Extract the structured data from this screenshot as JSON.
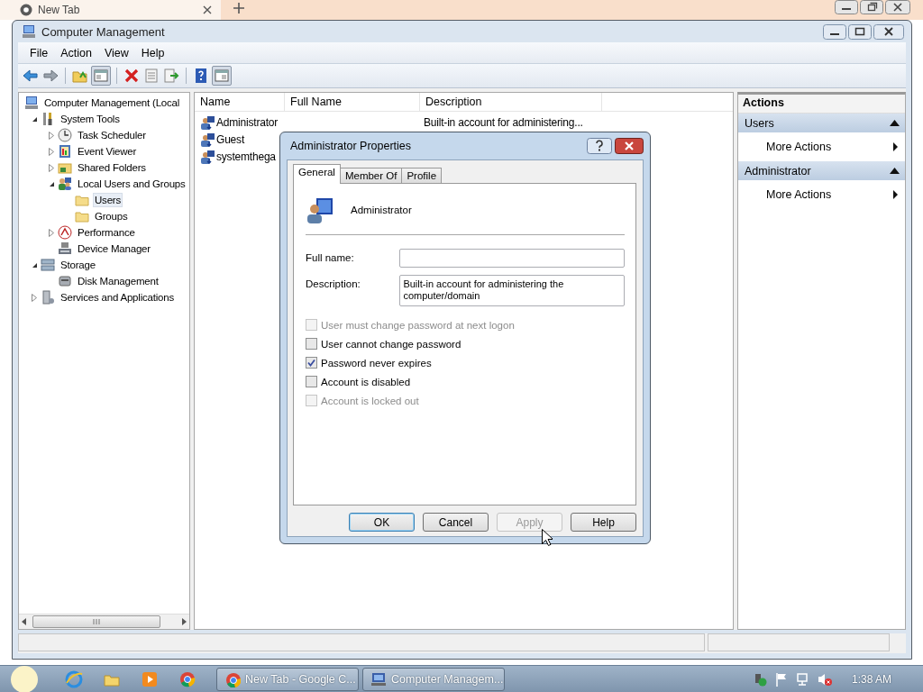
{
  "browser": {
    "tab": "New Tab"
  },
  "window": {
    "title": "Computer Management"
  },
  "menu": [
    "File",
    "Action",
    "View",
    "Help"
  ],
  "tree": [
    {
      "label": "Computer Management (Local",
      "selected": false,
      "children": [
        {
          "label": "System Tools",
          "expanded": true,
          "selected": false,
          "children": [
            {
              "label": "Task Scheduler",
              "expanded": false,
              "selected": false
            },
            {
              "label": "Event Viewer",
              "expanded": false,
              "selected": false
            },
            {
              "label": "Shared Folders",
              "expanded": false,
              "selected": false
            },
            {
              "label": "Local Users and Groups",
              "expanded": true,
              "selected": false,
              "children": [
                {
                  "label": "Users",
                  "selected": true
                },
                {
                  "label": "Groups",
                  "selected": false
                }
              ]
            },
            {
              "label": "Performance",
              "expanded": false,
              "selected": false
            },
            {
              "label": "Device Manager",
              "selected": false
            }
          ]
        },
        {
          "label": "Storage",
          "expanded": true,
          "selected": false,
          "children": [
            {
              "label": "Disk Management",
              "selected": false
            }
          ]
        },
        {
          "label": "Services and Applications",
          "expanded": false,
          "selected": false
        }
      ]
    }
  ],
  "users_table": {
    "columns": [
      "Name",
      "Full Name",
      "Description"
    ],
    "rows": [
      {
        "name": "Administrator",
        "description": "Built-in account for administering..."
      },
      {
        "name": "Guest"
      },
      {
        "name": "systemthega"
      }
    ]
  },
  "actions": {
    "title": "Actions",
    "groups": [
      {
        "title": "Users",
        "expanded": true,
        "items": [
          "More Actions"
        ]
      },
      {
        "title": "Administrator",
        "expanded": true,
        "items": [
          "More Actions"
        ]
      }
    ]
  },
  "dialog": {
    "title": "Administrator Properties",
    "tabs": [
      {
        "label": "General",
        "selected": true
      },
      {
        "label": "Member Of",
        "selected": false
      },
      {
        "label": "Profile",
        "selected": false
      }
    ],
    "user_name": "Administrator",
    "fields": [
      {
        "kind": "line",
        "label": "Full name:"
      },
      {
        "kind": "multiline",
        "label": "Description:",
        "value": "Built-in account for administering the computer/domain"
      }
    ],
    "checkboxes": [
      {
        "label": "User must change password at next logon",
        "checked": false,
        "disabled": true
      },
      {
        "label": "User cannot change password",
        "checked": false,
        "disabled": false
      },
      {
        "label": "Password never expires",
        "checked": true,
        "disabled": false
      },
      {
        "label": "Account is disabled",
        "checked": false,
        "disabled": false
      },
      {
        "label": "Account is locked out",
        "checked": false,
        "disabled": true
      }
    ],
    "buttons": [
      {
        "label": "OK",
        "default": true,
        "disabled": false
      },
      {
        "label": "Cancel",
        "default": false,
        "disabled": false
      },
      {
        "label": "Apply",
        "default": false,
        "disabled": true
      },
      {
        "label": "Help",
        "default": false,
        "disabled": false
      }
    ]
  },
  "taskbar": {
    "tasks": [
      {
        "label": "New Tab - Google C..."
      },
      {
        "label": "Computer Managem..."
      }
    ],
    "clock": "1:38 AM"
  }
}
